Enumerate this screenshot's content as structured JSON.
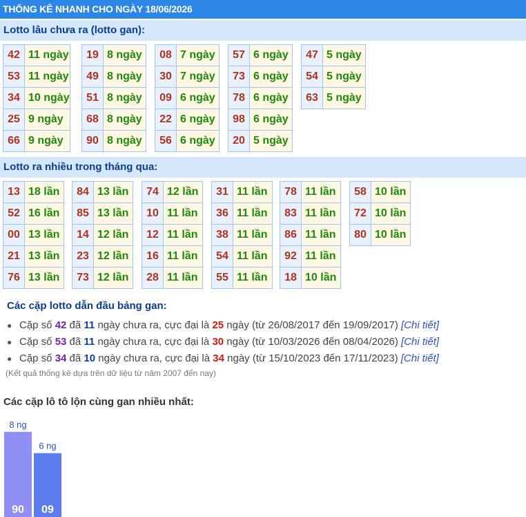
{
  "header": {
    "title": "THỐNG KÊ NHANH CHO NGÀY 18/06/2026"
  },
  "gan_section": {
    "title": "Lotto lâu chưa ra (lotto gan):",
    "groups": [
      [
        {
          "n": "42",
          "v": "11 ngày"
        },
        {
          "n": "53",
          "v": "11 ngày"
        },
        {
          "n": "34",
          "v": "10 ngày"
        },
        {
          "n": "25",
          "v": "9 ngày"
        },
        {
          "n": "66",
          "v": "9 ngày"
        }
      ],
      [
        {
          "n": "19",
          "v": "8 ngày"
        },
        {
          "n": "49",
          "v": "8 ngày"
        },
        {
          "n": "51",
          "v": "8 ngày"
        },
        {
          "n": "68",
          "v": "8 ngày"
        },
        {
          "n": "90",
          "v": "8 ngày"
        }
      ],
      [
        {
          "n": "08",
          "v": "7 ngày"
        },
        {
          "n": "30",
          "v": "7 ngày"
        },
        {
          "n": "09",
          "v": "6 ngày"
        },
        {
          "n": "22",
          "v": "6 ngày"
        },
        {
          "n": "56",
          "v": "6 ngày"
        }
      ],
      [
        {
          "n": "57",
          "v": "6 ngày"
        },
        {
          "n": "73",
          "v": "6 ngày"
        },
        {
          "n": "78",
          "v": "6 ngày"
        },
        {
          "n": "98",
          "v": "6 ngày"
        },
        {
          "n": "20",
          "v": "5 ngày"
        }
      ],
      [
        {
          "n": "47",
          "v": "5 ngày"
        },
        {
          "n": "54",
          "v": "5 ngày"
        },
        {
          "n": "63",
          "v": "5 ngày"
        }
      ]
    ]
  },
  "freq_section": {
    "title": "Lotto ra nhiều trong tháng qua:",
    "groups": [
      [
        {
          "n": "13",
          "v": "18 lần"
        },
        {
          "n": "52",
          "v": "16 lần"
        },
        {
          "n": "00",
          "v": "13 lần"
        },
        {
          "n": "21",
          "v": "13 lần"
        },
        {
          "n": "76",
          "v": "13 lần"
        }
      ],
      [
        {
          "n": "84",
          "v": "13 lần"
        },
        {
          "n": "85",
          "v": "13 lần"
        },
        {
          "n": "14",
          "v": "12 lần"
        },
        {
          "n": "23",
          "v": "12 lần"
        },
        {
          "n": "73",
          "v": "12 lần"
        }
      ],
      [
        {
          "n": "74",
          "v": "12 lần"
        },
        {
          "n": "10",
          "v": "11 lần"
        },
        {
          "n": "12",
          "v": "11 lần"
        },
        {
          "n": "16",
          "v": "11 lần"
        },
        {
          "n": "28",
          "v": "11 lần"
        }
      ],
      [
        {
          "n": "31",
          "v": "11 lần"
        },
        {
          "n": "36",
          "v": "11 lần"
        },
        {
          "n": "38",
          "v": "11 lần"
        },
        {
          "n": "54",
          "v": "11 lần"
        },
        {
          "n": "55",
          "v": "11 lần"
        }
      ],
      [
        {
          "n": "78",
          "v": "11 lần"
        },
        {
          "n": "83",
          "v": "11 lần"
        },
        {
          "n": "86",
          "v": "11 lần"
        },
        {
          "n": "92",
          "v": "11 lần"
        },
        {
          "n": "18",
          "v": "10 lần"
        }
      ],
      [
        {
          "n": "58",
          "v": "10 lần"
        },
        {
          "n": "72",
          "v": "10 lần"
        },
        {
          "n": "80",
          "v": "10 lần"
        }
      ]
    ]
  },
  "pairs_section": {
    "title": "Các cặp lotto dẫn đầu bảng gan:",
    "items": [
      {
        "prefix": "Cặp số ",
        "num": "42",
        "t1": " đã ",
        "days": "11",
        "t2": " ngày chưa ra, cực đại là ",
        "max": "25",
        "t3": " ngày (từ 26/08/2017 đến 19/09/2017) ",
        "link": "[Chi tiết]"
      },
      {
        "prefix": "Cặp số ",
        "num": "53",
        "t1": " đã ",
        "days": "11",
        "t2": " ngày chưa ra, cực đại là ",
        "max": "30",
        "t3": " ngày (từ 10/03/2026 đến 08/04/2026) ",
        "link": "[Chi tiết]"
      },
      {
        "prefix": "Cặp số ",
        "num": "34",
        "t1": " đã ",
        "days": "10",
        "t2": " ngày chưa ra, cực đại là ",
        "max": "34",
        "t3": " ngày (từ 15/10/2023 đến 17/11/2023) ",
        "link": "[Chi tiết]"
      }
    ],
    "note": "(Kết quả thống kê dựa trên dữ liệu từ năm 2007 đến nay)"
  },
  "chart_title": "Các cặp lô tô lộn cùng gan nhiều nhất:",
  "chart_data": {
    "type": "bar",
    "categories": [
      "90",
      "09"
    ],
    "values": [
      8,
      6
    ],
    "data_labels": [
      "8 ng",
      "6 ng"
    ],
    "colors": [
      "#8f8ff5",
      "#5c7cf0"
    ],
    "title": "",
    "xlabel": "",
    "ylabel": ""
  }
}
